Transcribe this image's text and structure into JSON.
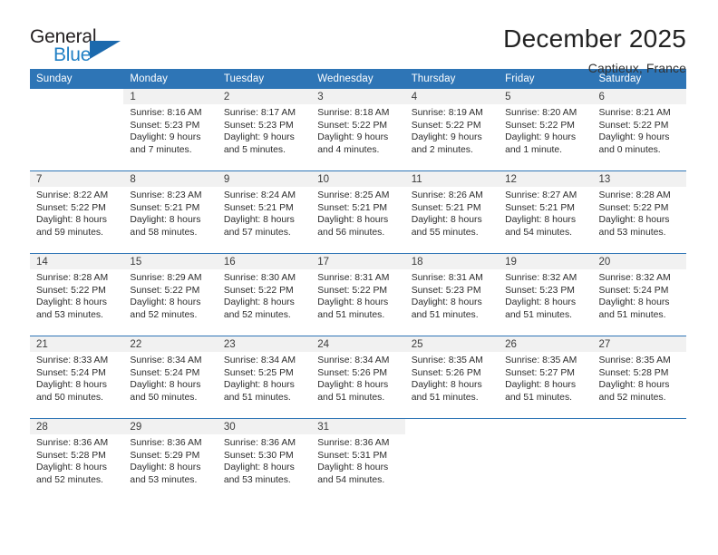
{
  "brand": {
    "name_part1": "General",
    "name_part2": "Blue",
    "logo_icon": "blue-triangle-icon",
    "accent_color": "#1f7fc4",
    "triangle_color": "#1b69ad"
  },
  "header": {
    "month_title": "December 2025",
    "location": "Captieux, France"
  },
  "theme": {
    "header_row_bg": "#2e75b6",
    "header_row_text": "#ffffff",
    "daynum_band_bg": "#f1f1f1",
    "week_divider": "#2e75b6",
    "body_text": "#2c2c2c"
  },
  "weekday_headers": [
    "Sunday",
    "Monday",
    "Tuesday",
    "Wednesday",
    "Thursday",
    "Friday",
    "Saturday"
  ],
  "weeks": [
    [
      {
        "day": "",
        "lines": []
      },
      {
        "day": "1",
        "lines": [
          "Sunrise: 8:16 AM",
          "Sunset: 5:23 PM",
          "Daylight: 9 hours",
          "and 7 minutes."
        ]
      },
      {
        "day": "2",
        "lines": [
          "Sunrise: 8:17 AM",
          "Sunset: 5:23 PM",
          "Daylight: 9 hours",
          "and 5 minutes."
        ]
      },
      {
        "day": "3",
        "lines": [
          "Sunrise: 8:18 AM",
          "Sunset: 5:22 PM",
          "Daylight: 9 hours",
          "and 4 minutes."
        ]
      },
      {
        "day": "4",
        "lines": [
          "Sunrise: 8:19 AM",
          "Sunset: 5:22 PM",
          "Daylight: 9 hours",
          "and 2 minutes."
        ]
      },
      {
        "day": "5",
        "lines": [
          "Sunrise: 8:20 AM",
          "Sunset: 5:22 PM",
          "Daylight: 9 hours",
          "and 1 minute."
        ]
      },
      {
        "day": "6",
        "lines": [
          "Sunrise: 8:21 AM",
          "Sunset: 5:22 PM",
          "Daylight: 9 hours",
          "and 0 minutes."
        ]
      }
    ],
    [
      {
        "day": "7",
        "lines": [
          "Sunrise: 8:22 AM",
          "Sunset: 5:22 PM",
          "Daylight: 8 hours",
          "and 59 minutes."
        ]
      },
      {
        "day": "8",
        "lines": [
          "Sunrise: 8:23 AM",
          "Sunset: 5:21 PM",
          "Daylight: 8 hours",
          "and 58 minutes."
        ]
      },
      {
        "day": "9",
        "lines": [
          "Sunrise: 8:24 AM",
          "Sunset: 5:21 PM",
          "Daylight: 8 hours",
          "and 57 minutes."
        ]
      },
      {
        "day": "10",
        "lines": [
          "Sunrise: 8:25 AM",
          "Sunset: 5:21 PM",
          "Daylight: 8 hours",
          "and 56 minutes."
        ]
      },
      {
        "day": "11",
        "lines": [
          "Sunrise: 8:26 AM",
          "Sunset: 5:21 PM",
          "Daylight: 8 hours",
          "and 55 minutes."
        ]
      },
      {
        "day": "12",
        "lines": [
          "Sunrise: 8:27 AM",
          "Sunset: 5:21 PM",
          "Daylight: 8 hours",
          "and 54 minutes."
        ]
      },
      {
        "day": "13",
        "lines": [
          "Sunrise: 8:28 AM",
          "Sunset: 5:22 PM",
          "Daylight: 8 hours",
          "and 53 minutes."
        ]
      }
    ],
    [
      {
        "day": "14",
        "lines": [
          "Sunrise: 8:28 AM",
          "Sunset: 5:22 PM",
          "Daylight: 8 hours",
          "and 53 minutes."
        ]
      },
      {
        "day": "15",
        "lines": [
          "Sunrise: 8:29 AM",
          "Sunset: 5:22 PM",
          "Daylight: 8 hours",
          "and 52 minutes."
        ]
      },
      {
        "day": "16",
        "lines": [
          "Sunrise: 8:30 AM",
          "Sunset: 5:22 PM",
          "Daylight: 8 hours",
          "and 52 minutes."
        ]
      },
      {
        "day": "17",
        "lines": [
          "Sunrise: 8:31 AM",
          "Sunset: 5:22 PM",
          "Daylight: 8 hours",
          "and 51 minutes."
        ]
      },
      {
        "day": "18",
        "lines": [
          "Sunrise: 8:31 AM",
          "Sunset: 5:23 PM",
          "Daylight: 8 hours",
          "and 51 minutes."
        ]
      },
      {
        "day": "19",
        "lines": [
          "Sunrise: 8:32 AM",
          "Sunset: 5:23 PM",
          "Daylight: 8 hours",
          "and 51 minutes."
        ]
      },
      {
        "day": "20",
        "lines": [
          "Sunrise: 8:32 AM",
          "Sunset: 5:24 PM",
          "Daylight: 8 hours",
          "and 51 minutes."
        ]
      }
    ],
    [
      {
        "day": "21",
        "lines": [
          "Sunrise: 8:33 AM",
          "Sunset: 5:24 PM",
          "Daylight: 8 hours",
          "and 50 minutes."
        ]
      },
      {
        "day": "22",
        "lines": [
          "Sunrise: 8:34 AM",
          "Sunset: 5:24 PM",
          "Daylight: 8 hours",
          "and 50 minutes."
        ]
      },
      {
        "day": "23",
        "lines": [
          "Sunrise: 8:34 AM",
          "Sunset: 5:25 PM",
          "Daylight: 8 hours",
          "and 51 minutes."
        ]
      },
      {
        "day": "24",
        "lines": [
          "Sunrise: 8:34 AM",
          "Sunset: 5:26 PM",
          "Daylight: 8 hours",
          "and 51 minutes."
        ]
      },
      {
        "day": "25",
        "lines": [
          "Sunrise: 8:35 AM",
          "Sunset: 5:26 PM",
          "Daylight: 8 hours",
          "and 51 minutes."
        ]
      },
      {
        "day": "26",
        "lines": [
          "Sunrise: 8:35 AM",
          "Sunset: 5:27 PM",
          "Daylight: 8 hours",
          "and 51 minutes."
        ]
      },
      {
        "day": "27",
        "lines": [
          "Sunrise: 8:35 AM",
          "Sunset: 5:28 PM",
          "Daylight: 8 hours",
          "and 52 minutes."
        ]
      }
    ],
    [
      {
        "day": "28",
        "lines": [
          "Sunrise: 8:36 AM",
          "Sunset: 5:28 PM",
          "Daylight: 8 hours",
          "and 52 minutes."
        ]
      },
      {
        "day": "29",
        "lines": [
          "Sunrise: 8:36 AM",
          "Sunset: 5:29 PM",
          "Daylight: 8 hours",
          "and 53 minutes."
        ]
      },
      {
        "day": "30",
        "lines": [
          "Sunrise: 8:36 AM",
          "Sunset: 5:30 PM",
          "Daylight: 8 hours",
          "and 53 minutes."
        ]
      },
      {
        "day": "31",
        "lines": [
          "Sunrise: 8:36 AM",
          "Sunset: 5:31 PM",
          "Daylight: 8 hours",
          "and 54 minutes."
        ]
      },
      {
        "day": "",
        "lines": []
      },
      {
        "day": "",
        "lines": []
      },
      {
        "day": "",
        "lines": []
      }
    ]
  ]
}
